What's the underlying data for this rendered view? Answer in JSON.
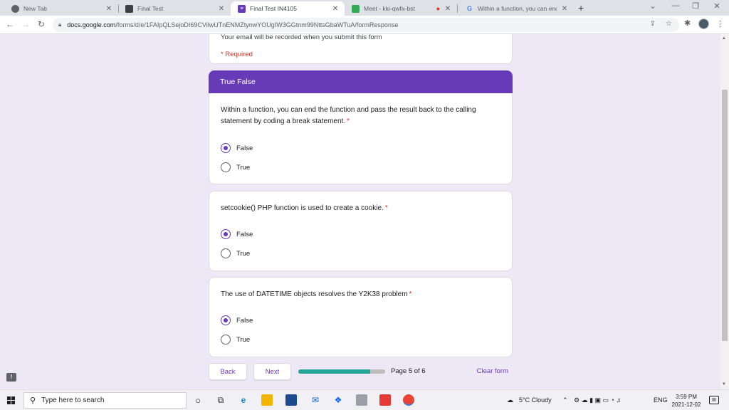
{
  "browser": {
    "tabs": [
      {
        "title": "New Tab",
        "icon": "chrome-icon"
      },
      {
        "title": "Final Test",
        "icon": "document-icon"
      },
      {
        "title": "Final Test IN4105",
        "icon": "forms-icon",
        "active": true
      },
      {
        "title": "Meet - kki-qwfa-bst",
        "icon": "meet-icon",
        "recording": true
      },
      {
        "title": "Within a function, you can end th",
        "icon": "google-icon"
      }
    ],
    "url_host": "docs.google.com",
    "url_path": "/forms/d/e/1FAIpQLSejoDI69CVilwUTnENMZtynwYOUgIW3GGtnm99NttsGbaWTuA/formResponse"
  },
  "form": {
    "email_note": "Your email will be recorded when you submit this form",
    "required_note": "* Required",
    "section_title": "True False",
    "questions": [
      {
        "text": "Within a function, you can end the function and pass the result back to the calling statement by coding a break statement.",
        "required_mark": "*",
        "options": [
          "False",
          "True"
        ],
        "selected": "False"
      },
      {
        "text": "setcookie() PHP function is used to create a cookie.",
        "required_mark": "*",
        "options": [
          "False",
          "True"
        ],
        "selected": "False"
      },
      {
        "text": "The use of DATETIME objects resolves the Y2K38 problem",
        "required_mark": "*",
        "options": [
          "False",
          "True"
        ],
        "selected": "False"
      }
    ],
    "back_label": "Back",
    "next_label": "Next",
    "page_label": "Page 5 of 6",
    "progress": 0.83,
    "clear_label": "Clear form"
  },
  "taskbar": {
    "search_placeholder": "Type here to search",
    "weather": "5°C  Cloudy",
    "language": "ENG",
    "time": "3:59 PM",
    "date": "2021-12-02"
  },
  "colors": {
    "accent": "#673ab7",
    "background": "#ede7f6",
    "required": "#d93025",
    "progress_fill": "#26a69a"
  }
}
